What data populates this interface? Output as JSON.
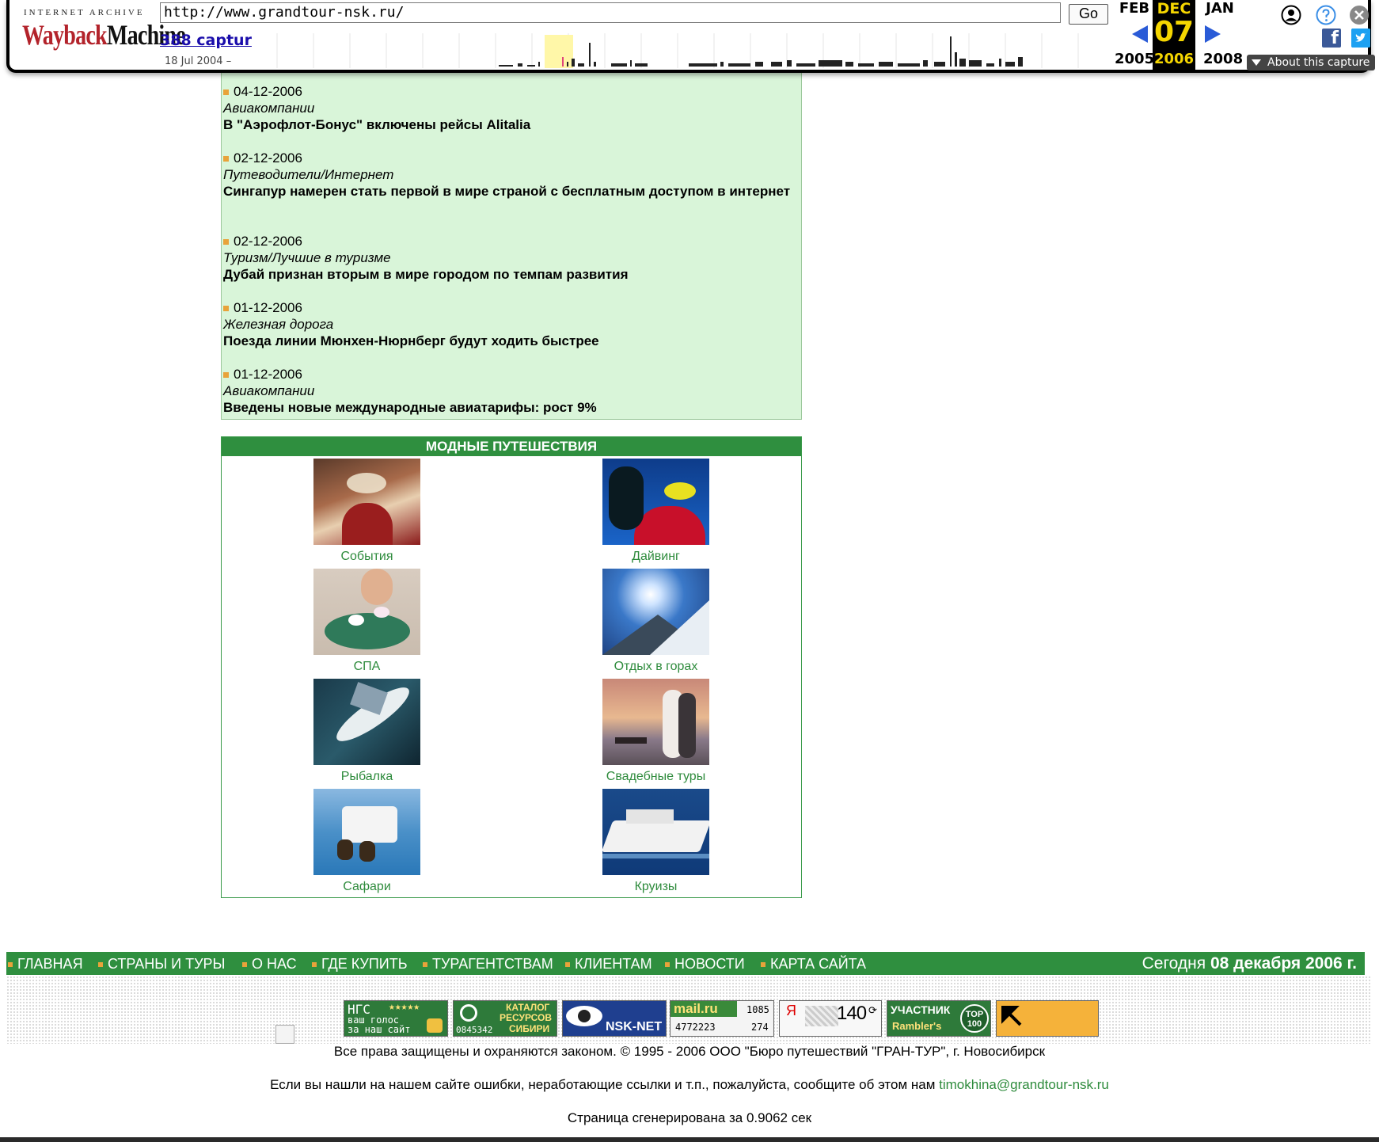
{
  "wayback": {
    "logo_top": "INTERNET ARCHIVE",
    "logo_main_a": "Wayback",
    "logo_main_b": "Machine",
    "url": "http://www.grandtour-nsk.ru/",
    "go_label": "Go",
    "captures": "388 captur",
    "date_range": "18 Jul 2004 –",
    "prev_month": "FEB",
    "prev_year": "2005",
    "cur_month": "DEC",
    "cur_day": "07",
    "cur_year": "2006",
    "next_month": "JAN",
    "next_year": "2008",
    "about": "About this capture"
  },
  "news": [
    {
      "date": "04-12-2006",
      "category": "Авиакомпании",
      "title": "В \"Аэрофлот-Бонус\" включены рейсы Alitalia"
    },
    {
      "date": "02-12-2006",
      "category": "Путеводители/Интернет",
      "title": "Сингапур намерен стать первой в мире страной с бесплатным доступом в интернет"
    },
    {
      "date": "02-12-2006",
      "category": "Туризм/Лучшие в туризме",
      "title": "Дубай признан вторым в мире городом по темпам развития"
    },
    {
      "date": "01-12-2006",
      "category": "Железная дорога",
      "title": "Поезда линии Мюнхен-Нюрнберг будут ходить быстрее"
    },
    {
      "date": "01-12-2006",
      "category": "Авиакомпании",
      "title": "Введены новые международные авиатарифы: рост 9%"
    }
  ],
  "travel": {
    "heading": "МОДНЫЕ ПУТЕШЕСТВИЯ",
    "items": [
      {
        "label": "События"
      },
      {
        "label": "Дайвинг"
      },
      {
        "label": "СПА"
      },
      {
        "label": "Отдых в горах"
      },
      {
        "label": "Рыбалка"
      },
      {
        "label": "Свадебные туры"
      },
      {
        "label": "Сафари"
      },
      {
        "label": "Круизы"
      }
    ]
  },
  "nav": {
    "items": [
      "ГЛАВНАЯ",
      "СТРАНЫ И ТУРЫ",
      "О НАС",
      "ГДЕ КУПИТЬ",
      "ТУРАГЕНТСТВАМ",
      "КЛИЕНТАМ",
      "НОВОСТИ",
      "КАРТА САЙТА"
    ],
    "date_prefix": "Сегодня",
    "date_value": "08 декабря 2006 г."
  },
  "counters": {
    "ngs_a": "НГС",
    "ngs_b": "ваш голос",
    "ngs_c": "за наш сайт",
    "catalog_a": "КАТАЛОГ",
    "catalog_b": "РЕСУРСОВ",
    "catalog_c": "СИБИРИ",
    "catalog_num": "0845342",
    "nsknet": "NSK-NET",
    "mail_logo": "mail.ru",
    "mail_a": "1085",
    "mail_b": "4772223",
    "mail_c": "274",
    "yandex_letter": "Я",
    "yandex_num": "140",
    "rambler_a": "УЧАСТНИК",
    "rambler_b": "Rambler's",
    "rambler_top": "TOP",
    "rambler_100": "100"
  },
  "footer": {
    "copyright": "Все права защищены и охраняются законом. © 1995 - 2006 ООО \"Бюро путешествий \"ГРАН-ТУР\", г. Новосибирск",
    "errors_text": "Если вы нашли на нашем сайте ошибки, неработающие ссылки и т.п., пожалуйста, сообщите об этом нам",
    "email": "timokhina@grandtour-nsk.ru",
    "generated": "Страница сгенерирована за 0.9062 сек"
  }
}
